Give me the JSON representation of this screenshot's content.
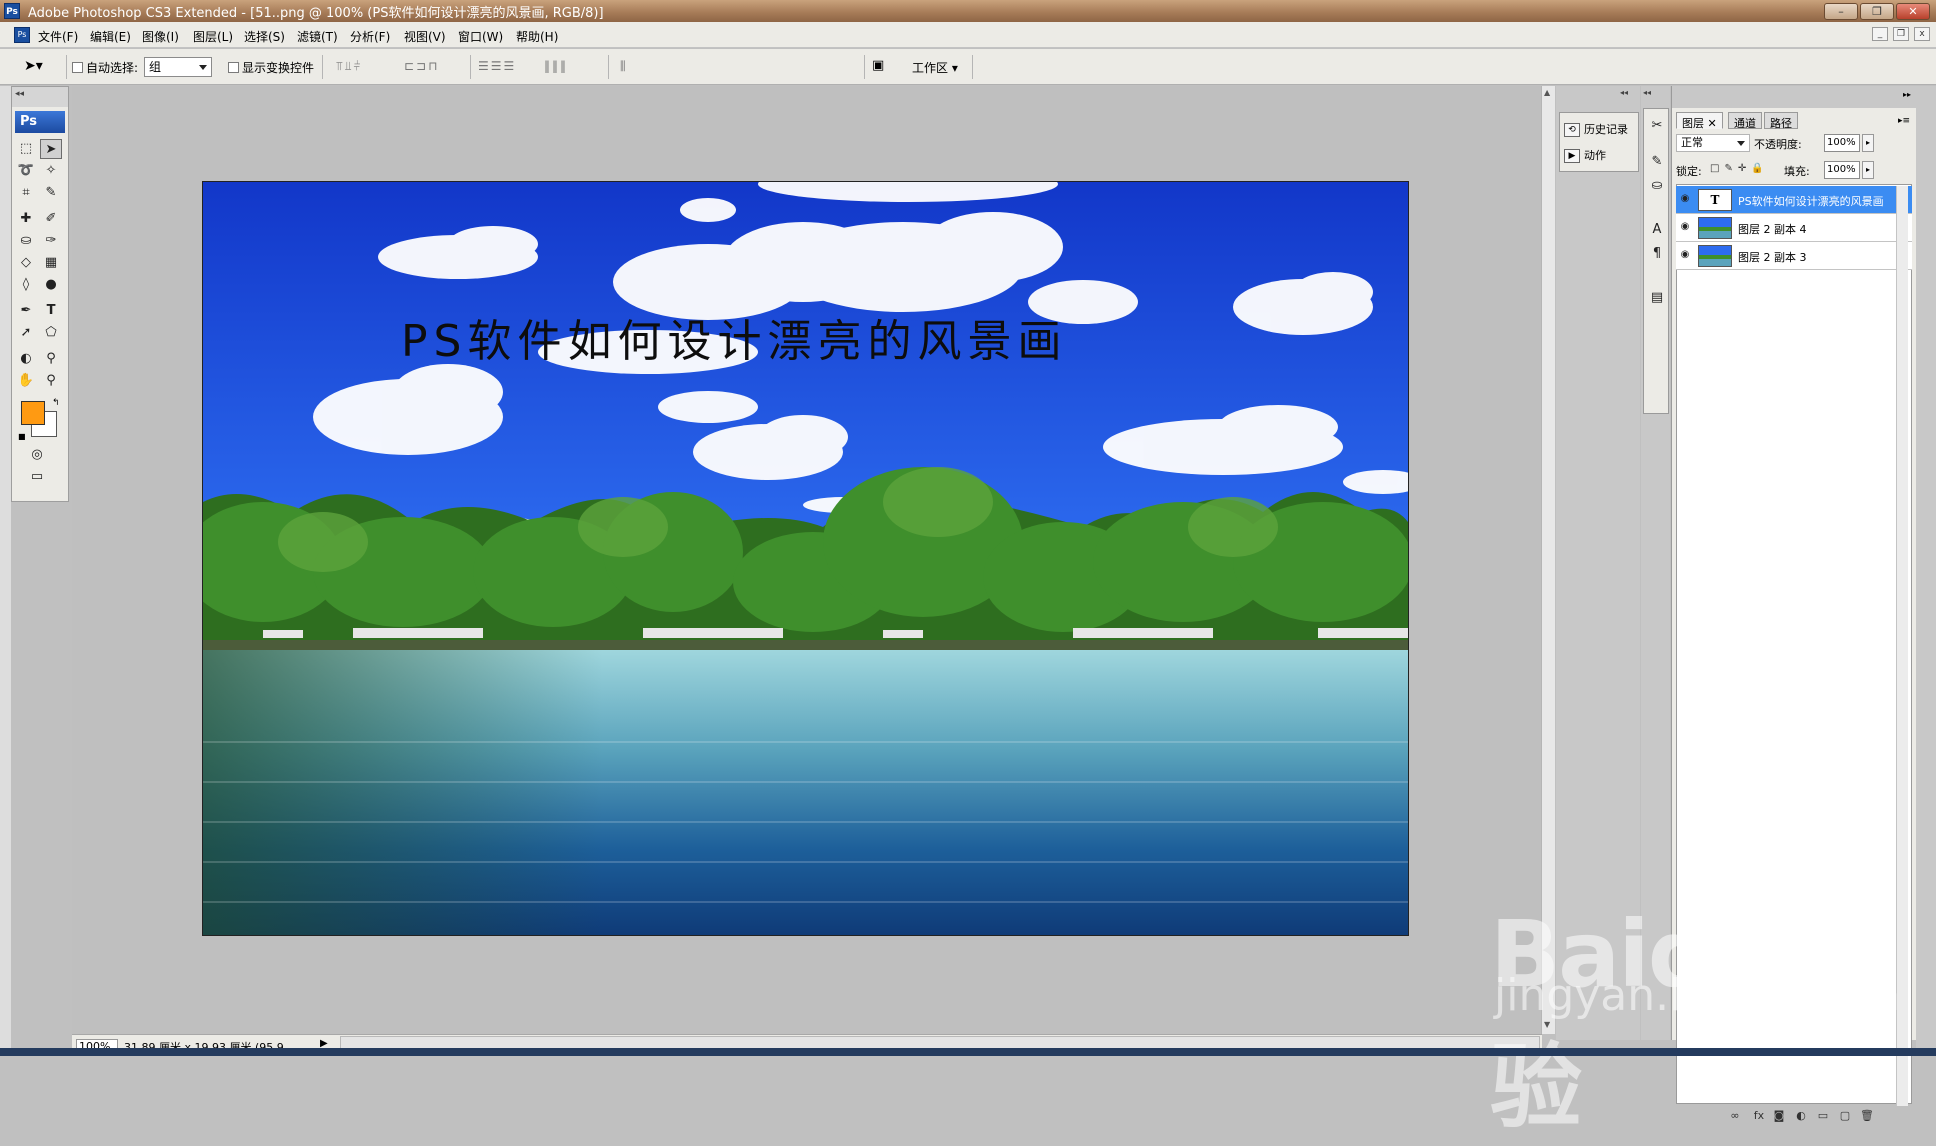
{
  "window": {
    "title": "Adobe Photoshop CS3 Extended - [51..png @ 100% (PS软件如何设计漂亮的风景画, RGB/8)]",
    "app_badge": "Ps"
  },
  "menu": [
    "文件(F)",
    "编辑(E)",
    "图像(I)",
    "图层(L)",
    "选择(S)",
    "滤镜(T)",
    "分析(F)",
    "视图(V)",
    "窗口(W)",
    "帮助(H)"
  ],
  "options": {
    "auto_select_label": "自动选择:",
    "auto_select_value": "组",
    "show_transform_label": "显示变换控件",
    "workspace_label": "工作区"
  },
  "toolbox": {
    "badge": "Ps",
    "foreground_color": "#ff9a12",
    "background_color": "#ffffff"
  },
  "canvas": {
    "text": "PS软件如何设计漂亮的风景画"
  },
  "status": {
    "zoom": "100%",
    "doc_info": "31.89 厘米 x 19.93 厘米 (95.9..."
  },
  "side_panel": {
    "history": "历史记录",
    "actions": "动作"
  },
  "layers_panel": {
    "tabs": [
      "图层",
      "通道",
      "路径"
    ],
    "blend_mode": "正常",
    "opacity_label": "不透明度:",
    "opacity_value": "100%",
    "lock_label": "锁定:",
    "fill_label": "填充:",
    "fill_value": "100%",
    "layers": [
      {
        "name": "PS软件如何设计漂亮的风景画",
        "type": "text",
        "thumb": "T",
        "selected": true
      },
      {
        "name": "图层 2 副本 4",
        "type": "image",
        "selected": false
      },
      {
        "name": "图层 2 副本 3",
        "type": "image",
        "selected": false
      }
    ]
  },
  "watermark": {
    "brand": "Baidu经验",
    "url": "jingyan.baidu.com"
  }
}
